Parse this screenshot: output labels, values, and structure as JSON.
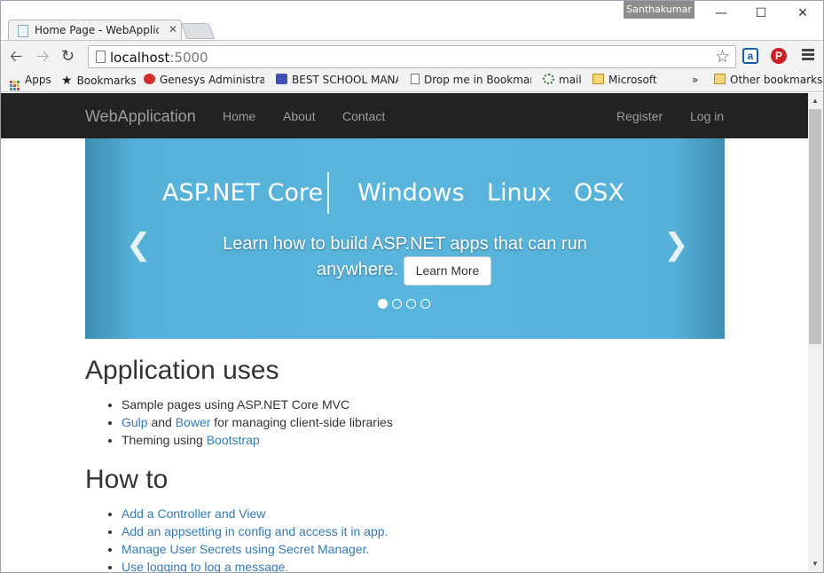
{
  "browser": {
    "user_badge": "Santhakumar",
    "tab_title": "Home Page - WebApplica",
    "url_host": "localhost",
    "url_port": ":5000"
  },
  "bookmarks": [
    {
      "label": "Apps"
    },
    {
      "label": "Bookmarks"
    },
    {
      "label": "Genesys Administrato"
    },
    {
      "label": "BEST SCHOOL MANA"
    },
    {
      "label": "Drop me in Bookmark"
    },
    {
      "label": "mail"
    },
    {
      "label": "Microsoft"
    },
    {
      "label": "»"
    },
    {
      "label": "Other bookmarks"
    }
  ],
  "navbar": {
    "brand": "WebApplication",
    "links": [
      "Home",
      "About",
      "Contact"
    ],
    "right_links": [
      "Register",
      "Log in"
    ]
  },
  "carousel": {
    "banner_items": [
      "ASP.NET Core",
      "Windows",
      "Linux",
      "OSX"
    ],
    "caption_line1": "Learn how to build ASP.NET apps that can run",
    "caption_line2": "anywhere.",
    "button": "Learn More",
    "slide_count": 4,
    "active_slide": 1
  },
  "uses": {
    "title": "Application uses",
    "item1": "Sample pages using ASP.NET Core MVC",
    "item2_link1": "Gulp",
    "item2_and": "and",
    "item2_link2": "Bower",
    "item2_rest": "for managing client-side libraries",
    "item3_text": "Theming using",
    "item3_link": "Bootstrap"
  },
  "howto": {
    "title": "How to",
    "items": [
      "Add a Controller and View",
      "Add an appsetting in config and access it in app.",
      "Manage User Secrets using Secret Manager.",
      "Use logging to log a message."
    ]
  },
  "colors": {
    "navbar_bg": "#222222",
    "link": "#337ab7",
    "carousel": "#5ab5dc"
  }
}
